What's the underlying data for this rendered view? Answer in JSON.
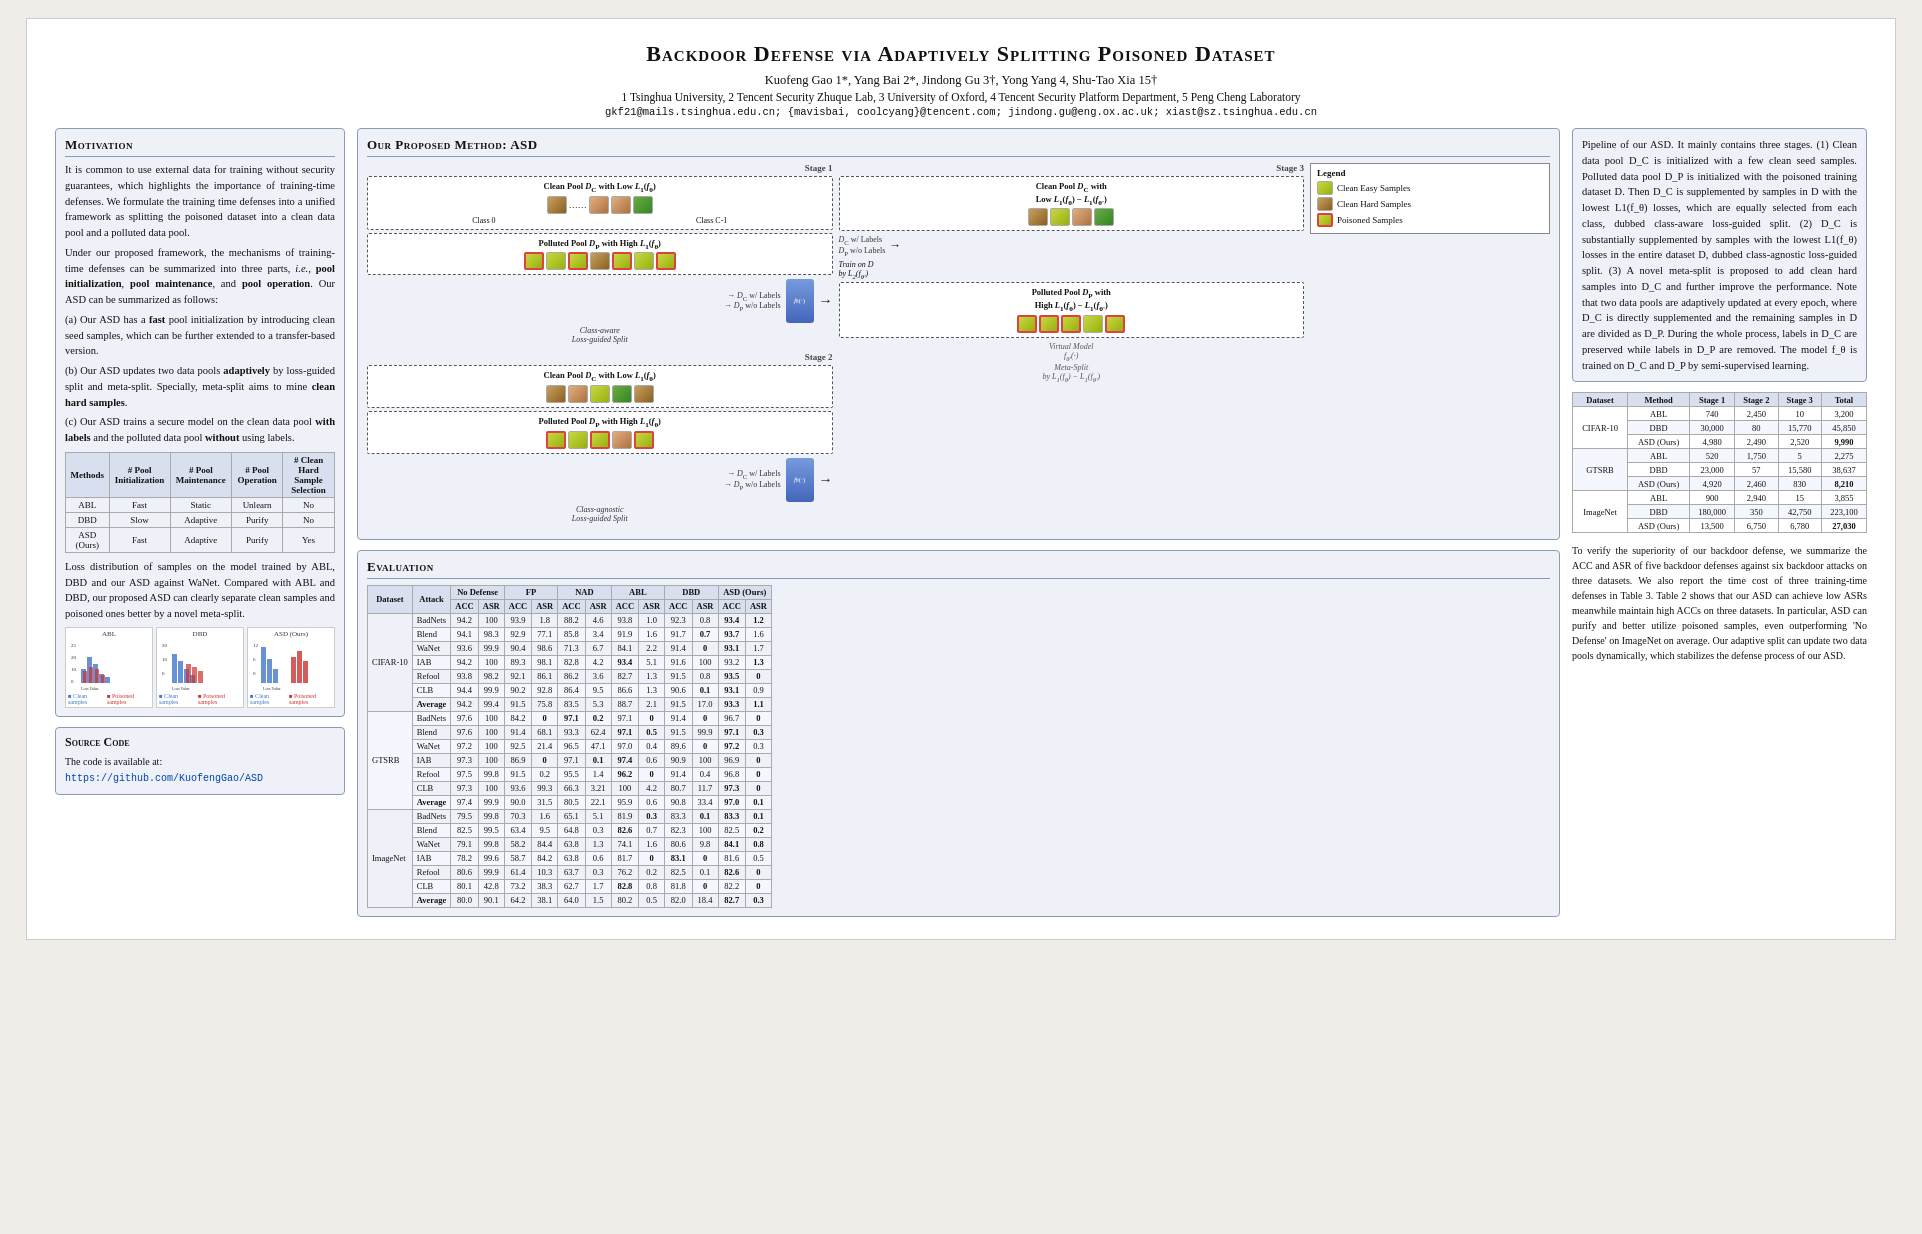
{
  "header": {
    "title": "Backdoor Defense via Adaptively Splitting Poisoned Dataset",
    "authors": "Kuofeng Gao 1*, Yang Bai 2*, Jindong Gu 3†, Yong Yang 4, Shu-Tao Xia 15†",
    "affiliations": "1 Tsinghua University, 2 Tencent Security Zhuque Lab, 3 University of Oxford, 4 Tencent Security Platform Department, 5 Peng Cheng Laboratory",
    "emails": "gkf21@mails.tsinghua.edu.cn; {mavisbai, coolcyang}@tencent.com; jindong.gu@eng.ox.ac.uk; xiast@sz.tsinghua.edu.cn"
  },
  "motivation": {
    "title": "Motivation",
    "body": "It is common to use external data for training without security guarantees, which highlights the importance of training-time defenses. We formulate the training time defenses into a unified framework as splitting the poisoned dataset into a clean data pool and a polluted data pool.\n\nUnder our proposed framework, the mechanisms of training-time defenses can be summarized into three parts, i.e., pool initialization, pool maintenance, and pool operation. Our ASD can be summarized as follows:\n(a) Our ASD has a fast pool initialization by introducing clean seed samples, which can be further extended to a transfer-based version.\n(b) Our ASD updates two data pools adaptively by loss-guided split and meta-split. Specially, meta-split aims to mine clean hard samples.\n(c) Our ASD trains a secure model on the clean data pool with labels and the polluted data pool without using labels."
  },
  "summary_table": {
    "headers": [
      "Methods",
      "# Pool Initialization",
      "# Pool Maintenance",
      "# Pool Operation",
      "# Clean Hard Sample Selection"
    ],
    "rows": [
      [
        "ABL",
        "Fast",
        "Static",
        "Unlearn",
        "No"
      ],
      [
        "DBD",
        "Slow",
        "Adaptive",
        "Purify",
        "No"
      ],
      [
        "ASD (Ours)",
        "Fast",
        "Adaptive",
        "Purify",
        "Yes"
      ]
    ]
  },
  "loss_plots": {
    "description": "Loss distribution of samples on the model trained by ABL, DBD and our ASD against WaNet.",
    "plots": [
      {
        "title": "ABL",
        "xlabel": "Loss Value",
        "ylabel": "Proportion %"
      },
      {
        "title": "DBD",
        "xlabel": "Loss Value",
        "ylabel": "Proportion %"
      },
      {
        "title": "ASD (Ours)",
        "xlabel": "Loss Value",
        "ylabel": "Proportion %"
      }
    ],
    "note": "Compared with ABL and DBD, our proposed ASD can clearly separate clean samples and poisoned ones better by a novel meta-split."
  },
  "method": {
    "title": "Our Proposed Method: ASD",
    "stage1_label": "Stage 1",
    "stage2_label": "Stage 2",
    "stage3_label": "Stage 3",
    "clean_pool_label": "Clean Pool D_C with Low L1(f_θ)",
    "polluted_pool_label": "Polluted Pool D_P with High L1(f_θ)",
    "class_aware_split": "Class-aware Loss-guided Split",
    "class_agnostic_split": "Class-agnostic Loss-guided Split",
    "meta_split": "Meta-Split",
    "dc_labels": "D_C w/ Labels",
    "dp_labels": "D_P w/o Labels",
    "model_notation": "f_θ(·)",
    "legend": {
      "title": "Legend",
      "items": [
        "Clean Easy Samples",
        "Clean Hard Samples",
        "Poisoned Samples"
      ]
    },
    "stage3_desc": "Clean Pool D_C with Low L1(f_θ) − L1(f_θ')",
    "virtual_model": "Virtual Model",
    "train_desc": "Train on D by L2(f_θ')",
    "by_notation": "by L1(f_θ) − L1(f_θ')"
  },
  "pipeline_text": "Pipeline of our ASD. It mainly contains three stages. (1) Clean data pool D_C is initialized with a few clean seed samples. Polluted data pool D_P is initialized with the poisoned training dataset D. Then D_C is supplemented by samples in D with the lowest L1(f_θ) losses, which are equally selected from each class, dubbed class-aware loss-guided split. (2) D_C is substantially supplemented by samples with the lowest L1(f_θ) losses in the entire dataset D, dubbed class-agnostic loss-guided split. (3) A novel meta-split is proposed to add clean hard samples into D_C and further improve the performance. Note that two data pools are adaptively updated at every epoch, where D_C is directly supplemented and the remaining samples in D are divided as D_P. During the whole process, labels in D_C are preserved while labels in D_P are removed. The model f_θ is trained on D_C and D_P by semi-supervised learning.",
  "evaluation": {
    "title": "Evaluation",
    "main_table": {
      "headers": [
        "Dataset",
        "Attack",
        "No Defense ACC",
        "No Defense ASR",
        "FP ACC",
        "FP ASR",
        "NAD ACC",
        "NAD ASR",
        "ABL ACC",
        "ABL ASR",
        "DBD ACC",
        "DBD ASR",
        "ASD (Ours) ACC",
        "ASD (Ours) ASR"
      ],
      "rows": [
        [
          "CIFAR-10",
          "BadNets",
          "94.2",
          "100",
          "93.9",
          "1.8",
          "88.2",
          "4.6",
          "93.8",
          "1.0",
          "92.3",
          "0.8",
          "93.4",
          "1.2"
        ],
        [
          "CIFAR-10",
          "Blend",
          "94.1",
          "98.3",
          "92.9",
          "77.1",
          "85.8",
          "3.4",
          "91.9",
          "1.6",
          "91.7",
          "0.7",
          "93.7",
          "1.6"
        ],
        [
          "CIFAR-10",
          "WaNet",
          "93.6",
          "99.9",
          "90.4",
          "98.6",
          "71.3",
          "6.7",
          "84.1",
          "2.2",
          "91.4",
          "0",
          "93.1",
          "1.7"
        ],
        [
          "CIFAR-10",
          "IAB",
          "94.2",
          "100",
          "89.3",
          "98.1",
          "82.8",
          "4.2",
          "93.4",
          "5.1",
          "91.6",
          "100",
          "93.2",
          "1.3"
        ],
        [
          "CIFAR-10",
          "Refool",
          "93.8",
          "98.2",
          "92.1",
          "86.1",
          "86.2",
          "3.6",
          "82.7",
          "1.3",
          "91.5",
          "0.8",
          "93.5",
          "0"
        ],
        [
          "CIFAR-10",
          "CLB",
          "94.4",
          "99.9",
          "90.2",
          "92.8",
          "86.4",
          "9.5",
          "86.6",
          "1.3",
          "90.6",
          "0.1",
          "93.1",
          "0.9"
        ],
        [
          "CIFAR-10",
          "Average",
          "94.2",
          "99.4",
          "91.5",
          "75.8",
          "83.5",
          "5.3",
          "88.7",
          "2.1",
          "91.5",
          "17.0",
          "93.3",
          "1.1"
        ],
        [
          "GTSRB",
          "BadNets",
          "97.6",
          "100",
          "84.2",
          "0",
          "97.1",
          "0.2",
          "97.1",
          "0",
          "91.4",
          "0",
          "96.7",
          "0"
        ],
        [
          "GTSRB",
          "Blend",
          "97.6",
          "100",
          "91.4",
          "68.1",
          "93.3",
          "62.4",
          "97.1",
          "0.5",
          "91.5",
          "99.9",
          "97.1",
          "0.3"
        ],
        [
          "GTSRB",
          "WaNet",
          "97.2",
          "100",
          "92.5",
          "21.4",
          "96.5",
          "47.1",
          "97.0",
          "0.4",
          "89.6",
          "0",
          "97.2",
          "0.3"
        ],
        [
          "GTSRB",
          "IAB",
          "97.3",
          "100",
          "86.9",
          "0",
          "97.1",
          "0.1",
          "97.4",
          "0.6",
          "90.9",
          "100",
          "96.9",
          "0"
        ],
        [
          "GTSRB",
          "Refool",
          "97.5",
          "99.8",
          "91.5",
          "0.2",
          "95.5",
          "1.4",
          "96.2",
          "0",
          "91.4",
          "0.4",
          "96.8",
          "0"
        ],
        [
          "GTSRB",
          "CLB",
          "97.3",
          "100",
          "93.6",
          "99.3",
          "66.3",
          "3.21",
          "100",
          "4.2",
          "80.7",
          "11.7",
          "97.3",
          "0"
        ],
        [
          "GTSRB",
          "Average",
          "97.4",
          "99.9",
          "90.0",
          "31.5",
          "80.5",
          "22.1",
          "95.9",
          "0.6",
          "90.8",
          "33.4",
          "97.0",
          "0.1"
        ],
        [
          "ImageNet",
          "BadNets",
          "79.5",
          "99.8",
          "70.3",
          "1.6",
          "65.1",
          "5.1",
          "81.9",
          "0.3",
          "83.3",
          "0.1",
          "83.3",
          "0.1"
        ],
        [
          "ImageNet",
          "Blend",
          "82.5",
          "99.5",
          "63.4",
          "9.5",
          "64.8",
          "0.3",
          "82.6",
          "0.7",
          "82.3",
          "100",
          "82.5",
          "0.2"
        ],
        [
          "ImageNet",
          "WaNet",
          "79.1",
          "99.8",
          "58.2",
          "84.4",
          "63.8",
          "1.3",
          "74.1",
          "1.6",
          "80.6",
          "9.8",
          "84.1",
          "0.8"
        ],
        [
          "ImageNet",
          "IAB",
          "78.2",
          "99.6",
          "58.7",
          "84.2",
          "63.8",
          "0.6",
          "81.7",
          "0",
          "83.1",
          "0",
          "81.6",
          "0.5"
        ],
        [
          "ImageNet",
          "Refool",
          "80.6",
          "99.9",
          "61.4",
          "10.3",
          "63.7",
          "0.3",
          "76.2",
          "0.2",
          "82.5",
          "0.1",
          "82.6",
          "0"
        ],
        [
          "ImageNet",
          "CLB",
          "80.1",
          "42.8",
          "73.2",
          "38.3",
          "62.7",
          "1.7",
          "82.8",
          "0.8",
          "81.8",
          "0",
          "82.2",
          "0"
        ],
        [
          "ImageNet",
          "Average",
          "80.0",
          "90.1",
          "64.2",
          "38.1",
          "64.0",
          "1.5",
          "80.2",
          "0.5",
          "82.0",
          "18.4",
          "82.7",
          "0.3"
        ]
      ]
    }
  },
  "right_table": {
    "headers": [
      "Dataset",
      "Method",
      "Stage 1",
      "Stage 2",
      "Stage 3",
      "Total"
    ],
    "rows": [
      [
        "CIFAR-10",
        "ABL",
        "740",
        "2,450",
        "10",
        "3,200"
      ],
      [
        "CIFAR-10",
        "DBD",
        "30,000",
        "80",
        "15,770",
        "45,850"
      ],
      [
        "CIFAR-10",
        "ASD (Ours)",
        "4,980",
        "2,490",
        "2,520",
        "9,990"
      ],
      [
        "GTSRB",
        "ABL",
        "520",
        "1,750",
        "5",
        "2,275"
      ],
      [
        "GTSRB",
        "DBD",
        "23,000",
        "57",
        "15,580",
        "38,637"
      ],
      [
        "GTSRB",
        "ASD (Ours)",
        "4,920",
        "2,460",
        "830",
        "8,210"
      ],
      [
        "ImageNet",
        "ABL",
        "900",
        "2,940",
        "15",
        "3,855"
      ],
      [
        "ImageNet",
        "DBD",
        "180,000",
        "350",
        "42,750",
        "223,100"
      ],
      [
        "ImageNet",
        "ASD (Ours)",
        "13,500",
        "6,750",
        "6,780",
        "27,030"
      ]
    ]
  },
  "right_text": "To verify the superiority of our backdoor defense, we summarize the ACC and ASR of five backdoor defenses against six backdoor attacks on three datasets. We also report the time cost of three training-time defenses in Table 3. Table 2 shows that our ASD can achieve low ASRs meanwhile maintain high ACCs on three datasets. In particular, ASD can purify and better utilize poisoned samples, even outperforming 'No Defense' on ImageNet on average. Our adaptive split can update two data pools dynamically, which stabilizes the defense process of our ASD.",
  "source_code": {
    "title": "Source Code",
    "description": "The code is available at:",
    "link": "https://github.com/KuofengGao/ASD"
  }
}
